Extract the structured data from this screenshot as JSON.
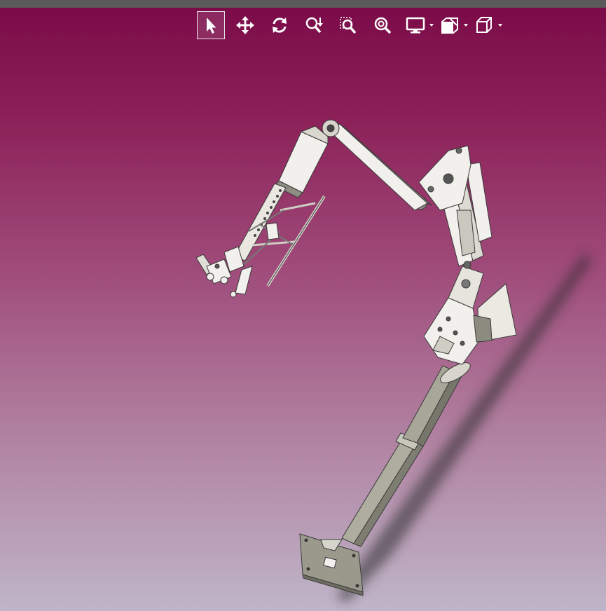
{
  "viewer": {
    "background_top": "#7a0a48",
    "background_bottom": "#bfb5c8",
    "toolbar_icon_color": "#ffffff"
  },
  "toolbar": {
    "buttons": [
      {
        "icon": "select-arrow-icon",
        "active": true
      },
      {
        "icon": "pan-icon",
        "active": false
      },
      {
        "icon": "rotate-icon",
        "active": false
      },
      {
        "icon": "zoom-icon",
        "active": false
      },
      {
        "icon": "zoom-window-icon",
        "active": false
      },
      {
        "icon": "zoom-fit-icon",
        "active": false
      },
      {
        "icon": "display-mode-icon",
        "dropdown": true
      },
      {
        "icon": "section-view-icon",
        "dropdown": true
      },
      {
        "icon": "view-orientation-icon",
        "dropdown": true
      }
    ]
  },
  "model": {
    "part_color": "#f2f0ec",
    "column_color": "#a7a698",
    "edge_color": "#3a3a3a",
    "shadow_color": "#2a2a2a"
  }
}
